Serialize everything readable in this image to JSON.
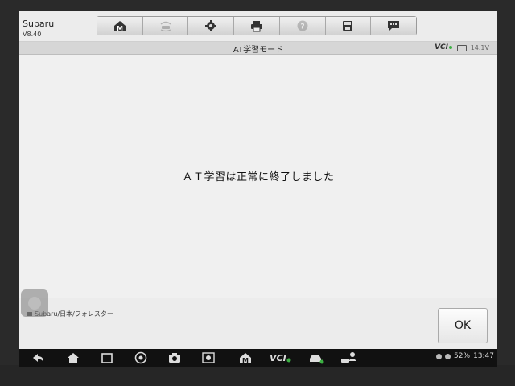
{
  "header": {
    "app_name": "Subaru",
    "version": "V8.40"
  },
  "toolbar": {
    "items": [
      {
        "name": "home-icon",
        "enabled": true
      },
      {
        "name": "vehicle-swap-icon",
        "enabled": false
      },
      {
        "name": "settings-icon",
        "enabled": true
      },
      {
        "name": "print-icon",
        "enabled": true
      },
      {
        "name": "help-icon",
        "enabled": false
      },
      {
        "name": "save-icon",
        "enabled": true
      },
      {
        "name": "message-icon",
        "enabled": true
      }
    ]
  },
  "title_bar": {
    "title": "AT学習モード",
    "vci": "VCI",
    "voltage": "14.1V"
  },
  "content": {
    "message": "ＡＴ学習は正常に終了しました"
  },
  "footer": {
    "breadcrumb": "Subaru/日本/フォレスター",
    "ok_label": "OK"
  },
  "system_bar": {
    "battery": "52%",
    "time": "13:47"
  },
  "colors": {
    "screen_bg": "#ededed",
    "vci_status": "#3cb043"
  }
}
